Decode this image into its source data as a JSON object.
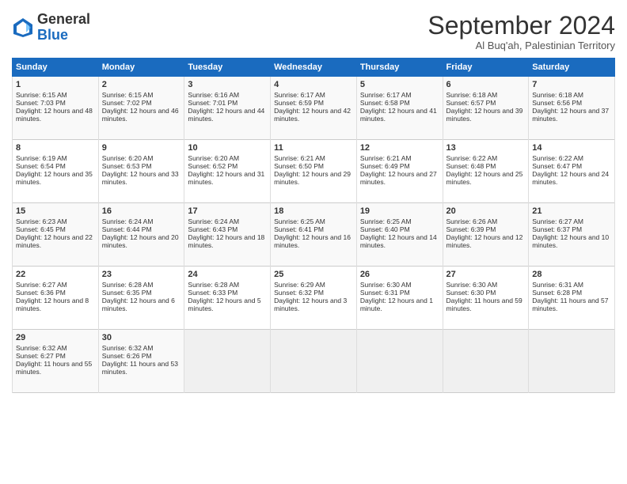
{
  "header": {
    "logo_general": "General",
    "logo_blue": "Blue",
    "month": "September 2024",
    "location": "Al Buq'ah, Palestinian Territory"
  },
  "days_of_week": [
    "Sunday",
    "Monday",
    "Tuesday",
    "Wednesday",
    "Thursday",
    "Friday",
    "Saturday"
  ],
  "weeks": [
    [
      {
        "day": 1,
        "sunrise": "6:15 AM",
        "sunset": "7:03 PM",
        "daylight": "12 hours and 48 minutes."
      },
      {
        "day": 2,
        "sunrise": "6:15 AM",
        "sunset": "7:02 PM",
        "daylight": "12 hours and 46 minutes."
      },
      {
        "day": 3,
        "sunrise": "6:16 AM",
        "sunset": "7:01 PM",
        "daylight": "12 hours and 44 minutes."
      },
      {
        "day": 4,
        "sunrise": "6:17 AM",
        "sunset": "6:59 PM",
        "daylight": "12 hours and 42 minutes."
      },
      {
        "day": 5,
        "sunrise": "6:17 AM",
        "sunset": "6:58 PM",
        "daylight": "12 hours and 41 minutes."
      },
      {
        "day": 6,
        "sunrise": "6:18 AM",
        "sunset": "6:57 PM",
        "daylight": "12 hours and 39 minutes."
      },
      {
        "day": 7,
        "sunrise": "6:18 AM",
        "sunset": "6:56 PM",
        "daylight": "12 hours and 37 minutes."
      }
    ],
    [
      {
        "day": 8,
        "sunrise": "6:19 AM",
        "sunset": "6:54 PM",
        "daylight": "12 hours and 35 minutes."
      },
      {
        "day": 9,
        "sunrise": "6:20 AM",
        "sunset": "6:53 PM",
        "daylight": "12 hours and 33 minutes."
      },
      {
        "day": 10,
        "sunrise": "6:20 AM",
        "sunset": "6:52 PM",
        "daylight": "12 hours and 31 minutes."
      },
      {
        "day": 11,
        "sunrise": "6:21 AM",
        "sunset": "6:50 PM",
        "daylight": "12 hours and 29 minutes."
      },
      {
        "day": 12,
        "sunrise": "6:21 AM",
        "sunset": "6:49 PM",
        "daylight": "12 hours and 27 minutes."
      },
      {
        "day": 13,
        "sunrise": "6:22 AM",
        "sunset": "6:48 PM",
        "daylight": "12 hours and 25 minutes."
      },
      {
        "day": 14,
        "sunrise": "6:22 AM",
        "sunset": "6:47 PM",
        "daylight": "12 hours and 24 minutes."
      }
    ],
    [
      {
        "day": 15,
        "sunrise": "6:23 AM",
        "sunset": "6:45 PM",
        "daylight": "12 hours and 22 minutes."
      },
      {
        "day": 16,
        "sunrise": "6:24 AM",
        "sunset": "6:44 PM",
        "daylight": "12 hours and 20 minutes."
      },
      {
        "day": 17,
        "sunrise": "6:24 AM",
        "sunset": "6:43 PM",
        "daylight": "12 hours and 18 minutes."
      },
      {
        "day": 18,
        "sunrise": "6:25 AM",
        "sunset": "6:41 PM",
        "daylight": "12 hours and 16 minutes."
      },
      {
        "day": 19,
        "sunrise": "6:25 AM",
        "sunset": "6:40 PM",
        "daylight": "12 hours and 14 minutes."
      },
      {
        "day": 20,
        "sunrise": "6:26 AM",
        "sunset": "6:39 PM",
        "daylight": "12 hours and 12 minutes."
      },
      {
        "day": 21,
        "sunrise": "6:27 AM",
        "sunset": "6:37 PM",
        "daylight": "12 hours and 10 minutes."
      }
    ],
    [
      {
        "day": 22,
        "sunrise": "6:27 AM",
        "sunset": "6:36 PM",
        "daylight": "12 hours and 8 minutes."
      },
      {
        "day": 23,
        "sunrise": "6:28 AM",
        "sunset": "6:35 PM",
        "daylight": "12 hours and 6 minutes."
      },
      {
        "day": 24,
        "sunrise": "6:28 AM",
        "sunset": "6:33 PM",
        "daylight": "12 hours and 5 minutes."
      },
      {
        "day": 25,
        "sunrise": "6:29 AM",
        "sunset": "6:32 PM",
        "daylight": "12 hours and 3 minutes."
      },
      {
        "day": 26,
        "sunrise": "6:30 AM",
        "sunset": "6:31 PM",
        "daylight": "12 hours and 1 minute."
      },
      {
        "day": 27,
        "sunrise": "6:30 AM",
        "sunset": "6:30 PM",
        "daylight": "11 hours and 59 minutes."
      },
      {
        "day": 28,
        "sunrise": "6:31 AM",
        "sunset": "6:28 PM",
        "daylight": "11 hours and 57 minutes."
      }
    ],
    [
      {
        "day": 29,
        "sunrise": "6:32 AM",
        "sunset": "6:27 PM",
        "daylight": "11 hours and 55 minutes."
      },
      {
        "day": 30,
        "sunrise": "6:32 AM",
        "sunset": "6:26 PM",
        "daylight": "11 hours and 53 minutes."
      },
      null,
      null,
      null,
      null,
      null
    ]
  ]
}
